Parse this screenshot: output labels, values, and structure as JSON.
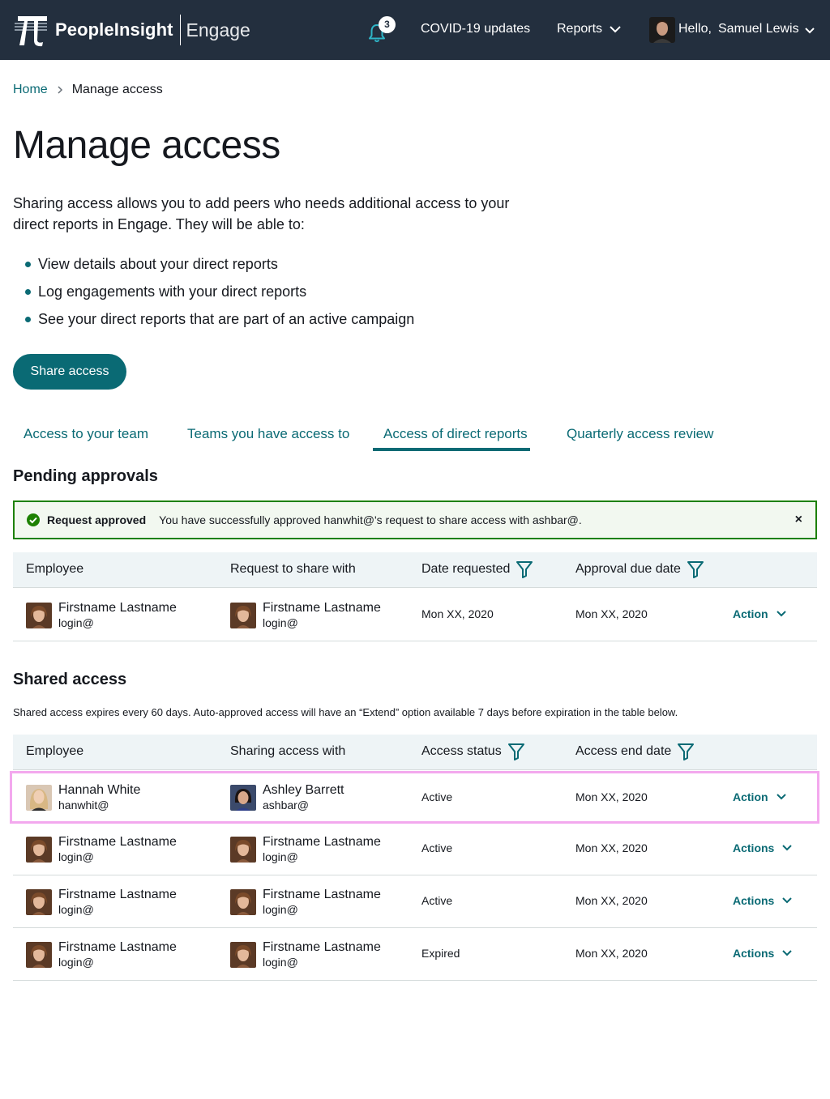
{
  "header": {
    "brand": "PeopleInsight",
    "product": "Engage",
    "notification_count": "3",
    "covid_link": "COVID-19 updates",
    "reports_menu": "Reports",
    "greeting": "Hello,",
    "user_name": "Samuel Lewis"
  },
  "breadcrumb": {
    "home": "Home",
    "current": "Manage access"
  },
  "page": {
    "title": "Manage access",
    "intro": "Sharing access allows you to add peers who needs additional access to your direct reports in Engage. They will be able to:",
    "bullets": [
      "View details about your direct reports",
      "Log engagements with your direct reports",
      "See your direct reports that are part of an active campaign"
    ],
    "share_button": "Share access"
  },
  "tabs": [
    {
      "label": "Access to your team"
    },
    {
      "label": "Teams you have access to"
    },
    {
      "label": "Access of direct reports",
      "active": true
    },
    {
      "label": "Quarterly access review"
    }
  ],
  "pending": {
    "title": "Pending approvals",
    "alert": {
      "title": "Request approved",
      "message": "You have successfully approved hanwhit@'s request to share access with ashbar@.",
      "close": "×"
    },
    "columns": [
      "Employee",
      "Request to share with",
      "Date requested",
      "Approval due date"
    ],
    "rows": [
      {
        "employee": {
          "name": "Firstname Lastname",
          "login": "login@"
        },
        "share_with": {
          "name": "Firstname Lastname",
          "login": "login@"
        },
        "date_requested": "Mon XX, 2020",
        "due_date": "Mon XX, 2020",
        "action": "Action"
      }
    ]
  },
  "shared": {
    "title": "Shared access",
    "note": "Shared access expires every 60 days. Auto-approved access will have an “Extend” option available 7 days before expiration in the table below.",
    "columns": [
      "Employee",
      "Sharing access with",
      "Access status",
      "Access end date"
    ],
    "rows": [
      {
        "employee": {
          "name": "Hannah White",
          "login": "hanwhit@"
        },
        "share_with": {
          "name": "Ashley Barrett",
          "login": "ashbar@"
        },
        "status": "Active",
        "end_date": "Mon XX, 2020",
        "action": "Action"
      },
      {
        "employee": {
          "name": "Firstname Lastname",
          "login": "login@"
        },
        "share_with": {
          "name": "Firstname Lastname",
          "login": "login@"
        },
        "status": "Active",
        "end_date": "Mon XX, 2020",
        "action": "Actions"
      },
      {
        "employee": {
          "name": "Firstname Lastname",
          "login": "login@"
        },
        "share_with": {
          "name": "Firstname Lastname",
          "login": "login@"
        },
        "status": "Active",
        "end_date": "Mon XX, 2020",
        "action": "Actions"
      },
      {
        "employee": {
          "name": "Firstname Lastname",
          "login": "login@"
        },
        "share_with": {
          "name": "Firstname Lastname",
          "login": "login@"
        },
        "status": "Expired",
        "end_date": "Mon XX, 2020",
        "action": "Actions"
      }
    ]
  },
  "colors": {
    "topbar": "#232f3e",
    "accent": "#0a6a74",
    "success": "#1d8102",
    "highlight_border": "#f3a8ee",
    "table_header": "#eef4f6"
  },
  "icons": [
    "logo-pi-icon",
    "bell-icon",
    "chevron-down-icon",
    "chevron-right-icon",
    "check-circle-icon",
    "close-icon",
    "filter-icon",
    "avatar"
  ]
}
